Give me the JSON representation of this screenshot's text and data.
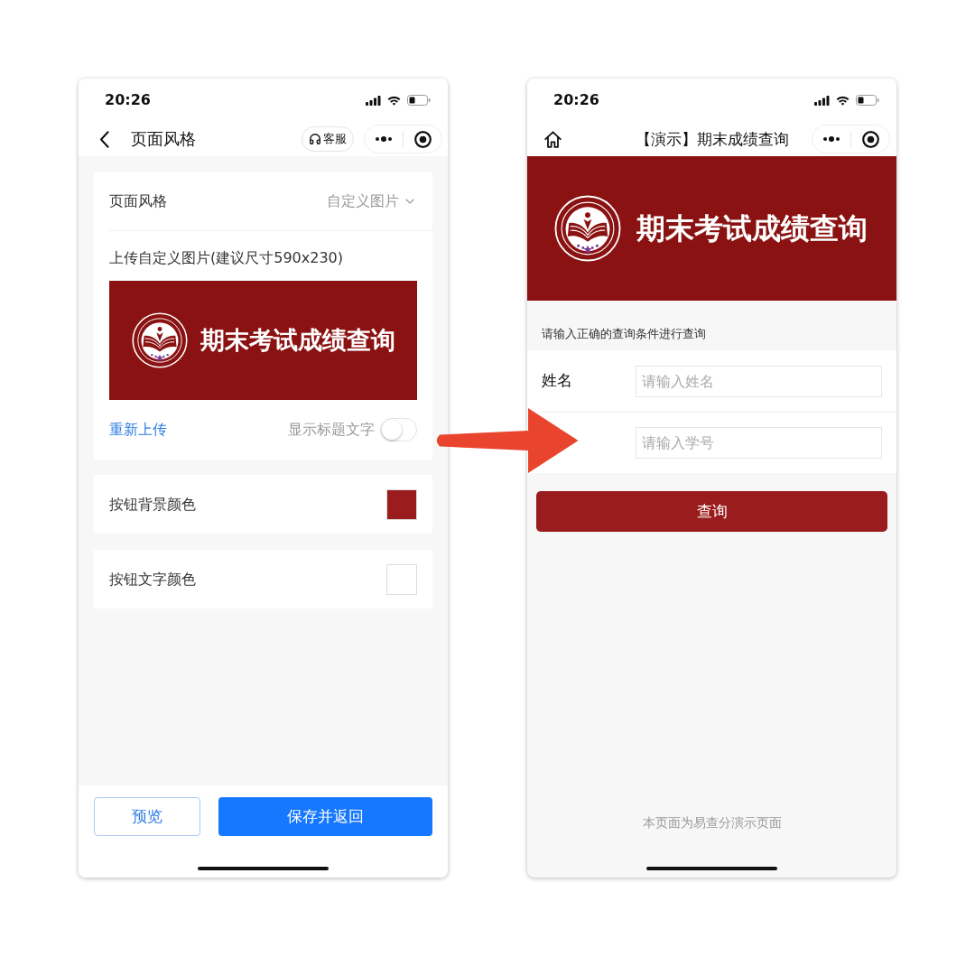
{
  "settings_screen": {
    "status_bar": {
      "time": "20:26"
    },
    "nav_bar": {
      "title": "页面风格",
      "service_button": "客服"
    },
    "page_style": {
      "label": "页面风格",
      "value": "自定义图片"
    },
    "upload": {
      "label": "上传自定义图片(建议尺寸590x230)",
      "banner": {
        "title": "期末考试成绩查询"
      },
      "reupload_link": "重新上传",
      "show_title_toggle": {
        "label": "显示标题文字",
        "on": false
      }
    },
    "color_settings": [
      {
        "label": "按钮背景颜色",
        "color": "#9b1c1c"
      },
      {
        "label": "按钮文字颜色",
        "color": "#ffffff"
      }
    ],
    "buttons": [
      {
        "label": "预览",
        "kind": "outline"
      },
      {
        "label": "保存并返回",
        "kind": "primary"
      }
    ]
  },
  "preview_screen": {
    "status_bar": {
      "time": "20:26"
    },
    "nav_bar": {
      "title": "【演示】期末成绩查询"
    },
    "banner": {
      "title": "期末考试成绩查询"
    },
    "hint": "请输入正确的查询条件进行查询",
    "fields": [
      {
        "label": "姓名",
        "placeholder": "请输入姓名"
      },
      {
        "placeholder": "请输入学号"
      }
    ],
    "submit_button": "查询",
    "footer": "本页面为易查分演示页面"
  }
}
